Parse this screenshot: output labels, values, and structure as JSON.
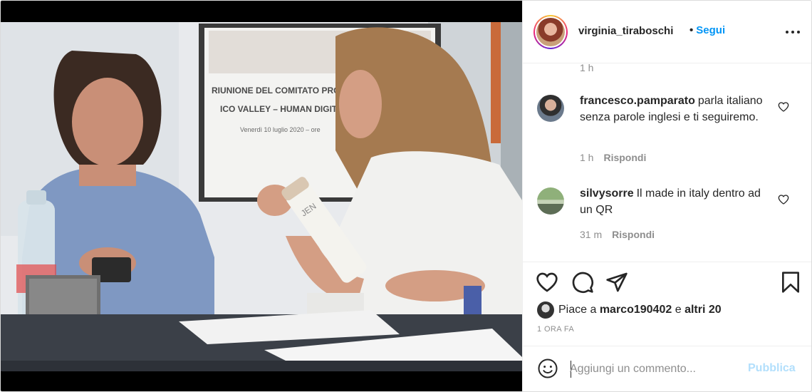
{
  "post": {
    "username": "virginia_tiraboschi",
    "bullet": "•",
    "follow_label": "Segui",
    "more_icon": "more-options-icon"
  },
  "image_text": {
    "poster_line1": "RIUNIONE DEL COMITATO PRO",
    "poster_line2": "ICO VALLEY – HUMAN DIGIT",
    "poster_line3": "Venerdì 10 luglio 2020 – ore",
    "bottle_label": "JEN"
  },
  "comments": {
    "top_time": "1 h",
    "items": [
      {
        "user": "francesco.pamparato",
        "text": "parla italiano senza parole inglesi e ti seguiremo.",
        "time": "1 h",
        "reply": "Rispondi"
      },
      {
        "user": "silvysorre",
        "text": "Il made in italy dentro ad un QR",
        "time": "31 m",
        "reply": "Rispondi"
      }
    ]
  },
  "actions": {
    "icons": [
      "heart-icon",
      "comment-icon",
      "share-icon",
      "bookmark-icon"
    ],
    "likes_prefix": "Piace a",
    "likes_user": "marco190402",
    "likes_mid": "e",
    "likes_others": "altri 20",
    "time_ago": "1 ORA FA"
  },
  "composer": {
    "placeholder": "Aggiungi un commento...",
    "publish_label": "Pubblica"
  },
  "colors": {
    "link_blue": "#0095f6",
    "publish_disabled": "#b2dffc",
    "muted_text": "#8e8e8e"
  }
}
